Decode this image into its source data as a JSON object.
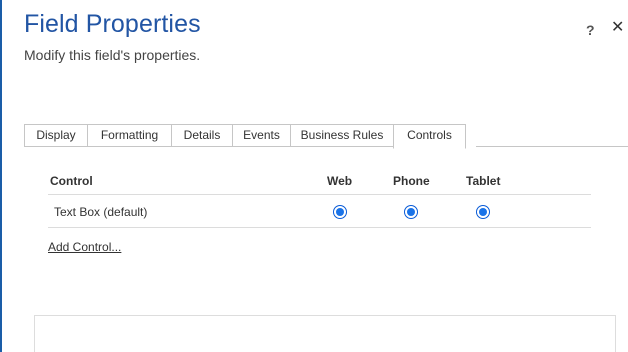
{
  "dialog": {
    "title": "Field Properties",
    "subtitle": "Modify this field's properties.",
    "help_label": "?",
    "close_label": "✕"
  },
  "tabs": [
    {
      "label": "Display",
      "active": false
    },
    {
      "label": "Formatting",
      "active": false
    },
    {
      "label": "Details",
      "active": false
    },
    {
      "label": "Events",
      "active": false
    },
    {
      "label": "Business Rules",
      "active": false
    },
    {
      "label": "Controls",
      "active": true
    }
  ],
  "controls_grid": {
    "headers": {
      "control": "Control",
      "web": "Web",
      "phone": "Phone",
      "tablet": "Tablet"
    },
    "rows": [
      {
        "control": "Text Box (default)",
        "web_selected": true,
        "phone_selected": true,
        "tablet_selected": true
      }
    ]
  },
  "add_control_label": "Add Control...",
  "colors": {
    "title": "#2255a4",
    "accent_border": "#1a5da8",
    "radio_fill": "#1a73e8"
  }
}
